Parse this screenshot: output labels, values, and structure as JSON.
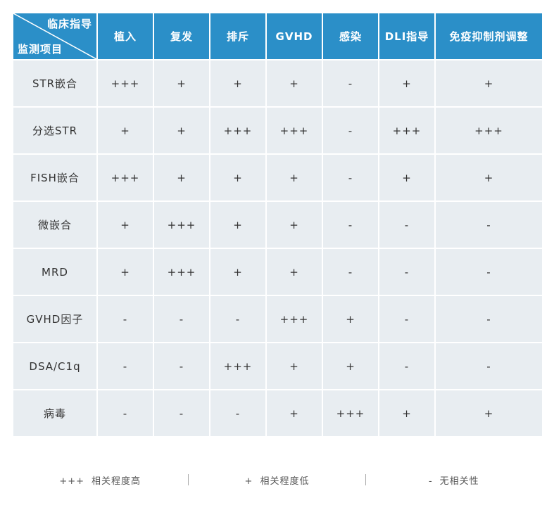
{
  "table": {
    "corner": {
      "top_label": "临床指导",
      "bottom_label": "监测项目"
    },
    "columns": [
      "植入",
      "复发",
      "排斥",
      "GVHD",
      "感染",
      "DLI指导",
      "免疫抑制剂调整"
    ],
    "rows": [
      {
        "label": "STR嵌合",
        "cells": [
          "+++",
          "+",
          "+",
          "+",
          "-",
          "+",
          "+"
        ]
      },
      {
        "label": "分选STR",
        "cells": [
          "+",
          "+",
          "+++",
          "+++",
          "-",
          "+++",
          "+++"
        ]
      },
      {
        "label": "FISH嵌合",
        "cells": [
          "+++",
          "+",
          "+",
          "+",
          "-",
          "+",
          "+"
        ]
      },
      {
        "label": "微嵌合",
        "cells": [
          "+",
          "+++",
          "+",
          "+",
          "-",
          "-",
          "-"
        ]
      },
      {
        "label": "MRD",
        "cells": [
          "+",
          "+++",
          "+",
          "+",
          "-",
          "-",
          "-"
        ]
      },
      {
        "label": "GVHD因子",
        "cells": [
          "-",
          "-",
          "-",
          "+++",
          "+",
          "-",
          "-"
        ]
      },
      {
        "label": "DSA/C1q",
        "cells": [
          "-",
          "-",
          "+++",
          "+",
          "+",
          "-",
          "-"
        ]
      },
      {
        "label": "病毒",
        "cells": [
          "-",
          "-",
          "-",
          "+",
          "+++",
          "+",
          "+"
        ]
      }
    ]
  },
  "legend": [
    {
      "symbol": "+++",
      "text": "相关程度高"
    },
    {
      "symbol": "+",
      "text": "相关程度低"
    },
    {
      "symbol": "-",
      "text": "无相关性"
    }
  ],
  "colors": {
    "header_bg": "#2b8fc8",
    "cell_bg": "#e8edf1"
  }
}
